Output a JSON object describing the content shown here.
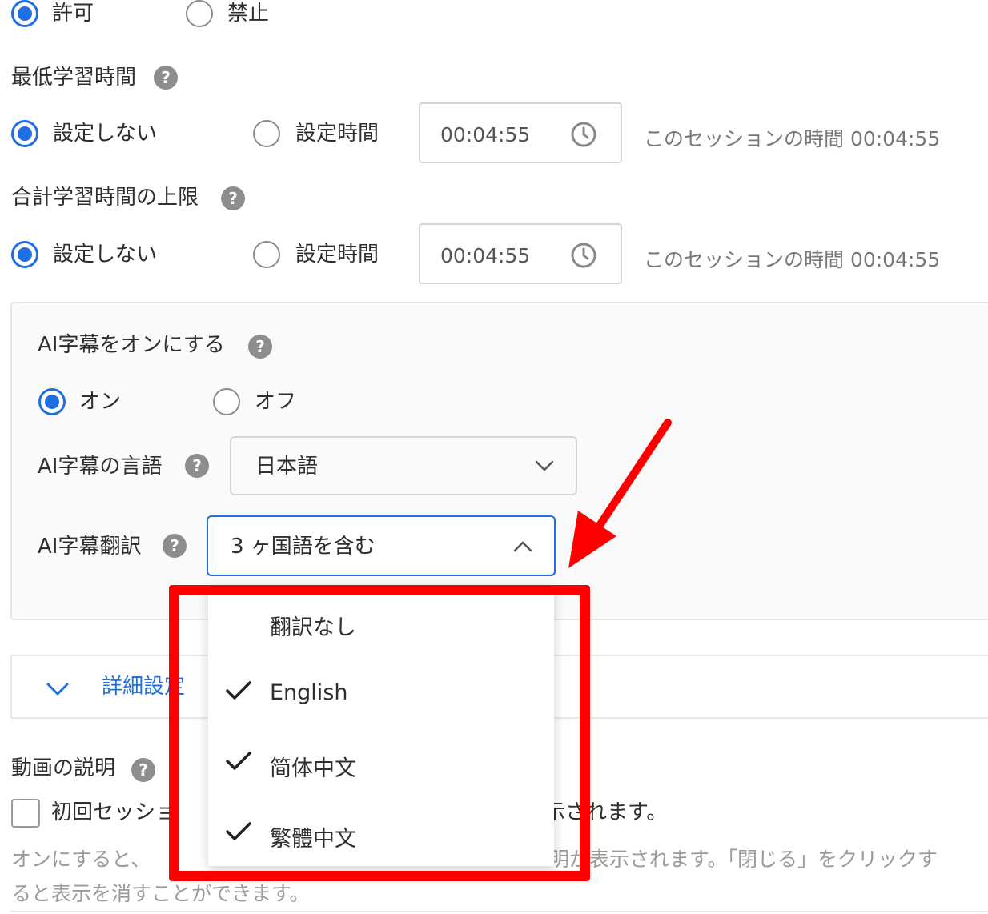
{
  "permission": {
    "options": [
      {
        "label": "許可",
        "selected": true
      },
      {
        "label": "禁止",
        "selected": false
      }
    ]
  },
  "min_study_time": {
    "title": "最低学習時間",
    "options": [
      {
        "label": "設定しない",
        "selected": true
      },
      {
        "label": "設定時間",
        "selected": false
      }
    ],
    "time_value": "00:04:55",
    "session_note": "このセッションの時間 00:04:55"
  },
  "max_study_time": {
    "title": "合計学習時間の上限",
    "options": [
      {
        "label": "設定しない",
        "selected": true
      },
      {
        "label": "設定時間",
        "selected": false
      }
    ],
    "time_value": "00:04:55",
    "session_note": "このセッションの時間 00:04:55"
  },
  "ai_subtitle": {
    "title": "AI字幕をオンにする",
    "options": [
      {
        "label": "オン",
        "selected": true
      },
      {
        "label": "オフ",
        "selected": false
      }
    ],
    "language_label": "AI字幕の言語",
    "language_value": "日本語",
    "translation_label": "AI字幕翻訳",
    "translation_value": "3 ヶ国語を含む",
    "translation_options": [
      {
        "label": "翻訳なし",
        "checked": false
      },
      {
        "label": "English",
        "checked": true
      },
      {
        "label": "简体中文",
        "checked": true
      },
      {
        "label": "繁體中文",
        "checked": true
      }
    ]
  },
  "advanced": {
    "label": "詳細設定"
  },
  "video_description": {
    "title": "動画の説明",
    "checkbox_label_start": "初回セッショ",
    "checkbox_label_end": "示されます。",
    "note_line1_start": "オンにすると、",
    "note_line1_end": "明が表示されます。「閉じる」をクリックす",
    "note_line2": "ると表示を消すことができます。"
  },
  "colors": {
    "accent": "#1f6fe0",
    "highlight": "#ff0000"
  }
}
